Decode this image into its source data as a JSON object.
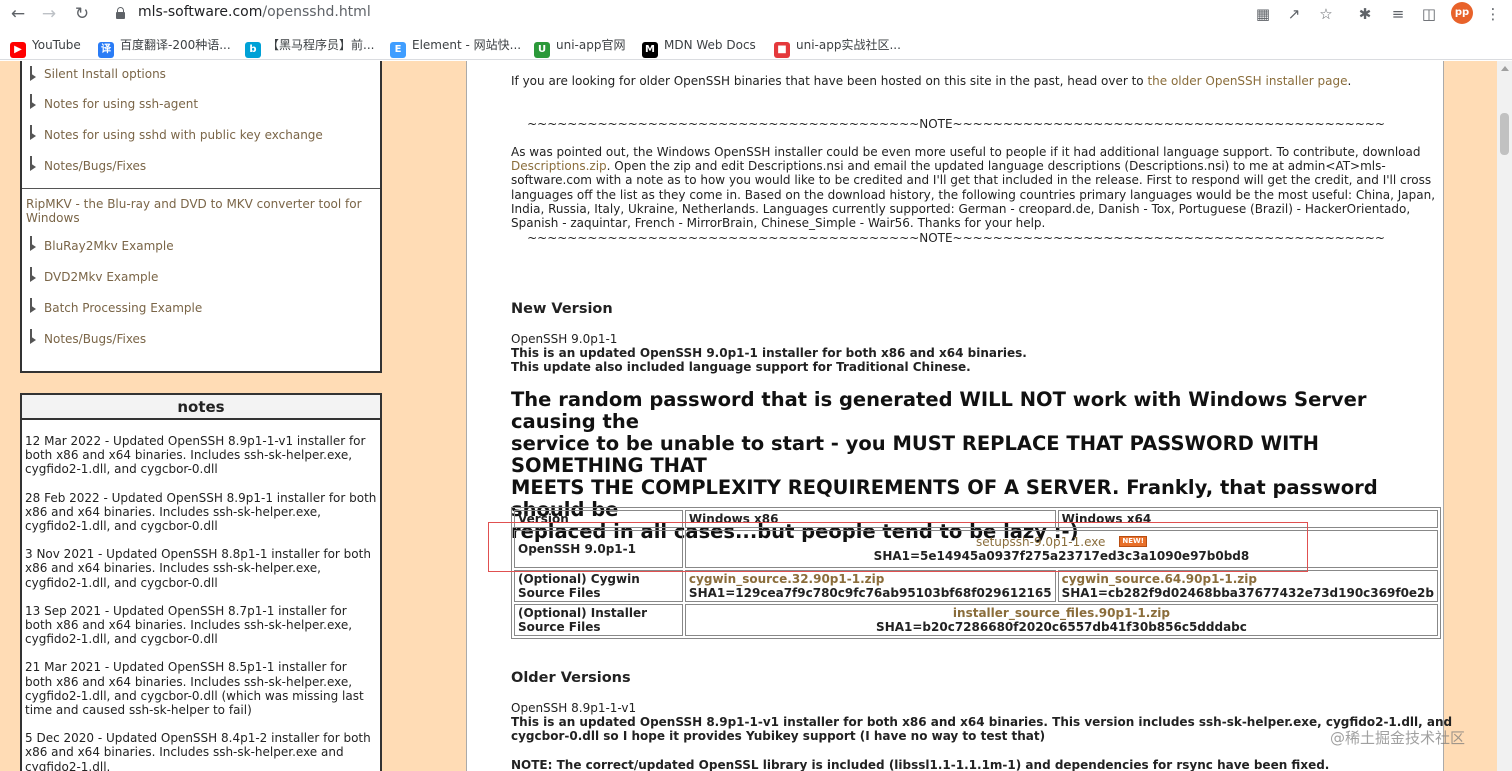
{
  "browser": {
    "url_domain": "mls-software.com",
    "url_path": "/opensshd.html",
    "avatar_initials": "pp",
    "bookmarks": [
      {
        "label": "YouTube",
        "icon": "youtube-icon",
        "color": "#ff0000"
      },
      {
        "label": "百度翻译-200种语...",
        "icon": "baidu-translate-icon",
        "color": "#2a7cf6"
      },
      {
        "label": "【黑马程序员】前...",
        "icon": "bilibili-icon",
        "color": "#00a1d6"
      },
      {
        "label": "Element - 网站快...",
        "icon": "element-icon",
        "color": "#409eff"
      },
      {
        "label": "uni-app官网",
        "icon": "uniapp-icon",
        "color": "#2b9939"
      },
      {
        "label": "MDN Web Docs",
        "icon": "mdn-icon",
        "color": "#000000"
      },
      {
        "label": "uni-app实战社区...",
        "icon": "uniapp-community-icon",
        "color": "#e4393c"
      }
    ]
  },
  "sidebar": {
    "group1": [
      "Silent Install options",
      "Notes for using ssh-agent",
      "Notes for using sshd with public key exchange",
      "Notes/Bugs/Fixes"
    ],
    "group2_head": "RipMKV - the Blu-ray and DVD to MKV converter tool for Windows",
    "group2": [
      "BluRay2Mkv Example",
      "DVD2Mkv Example",
      "Batch Processing Example",
      "Notes/Bugs/Fixes"
    ]
  },
  "notes": {
    "title": "notes",
    "items": [
      "12 Mar 2022 - Updated OpenSSH 8.9p1-1-v1 installer for both x86 and x64 binaries. Includes ssh-sk-helper.exe, cygfido2-1.dll, and cygcbor-0.dll",
      "28 Feb 2022 - Updated OpenSSH 8.9p1-1 installer for both x86 and x64 binaries. Includes ssh-sk-helper.exe, cygfido2-1.dll, and cygcbor-0.dll",
      "3 Nov 2021 - Updated OpenSSH 8.8p1-1 installer for both x86 and x64 binaries. Includes ssh-sk-helper.exe, cygfido2-1.dll, and cygcbor-0.dll",
      "13 Sep 2021 - Updated OpenSSH 8.7p1-1 installer for both x86 and x64 binaries. Includes ssh-sk-helper.exe, cygfido2-1.dll, and cygcbor-0.dll",
      "21 Mar 2021 - Updated OpenSSH 8.5p1-1 installer for both x86 and x64 binaries. Includes ssh-sk-helper.exe, cygfido2-1.dll, and cygcbor-0.dll (which was missing last time and caused ssh-sk-helper to fail)",
      "5 Dec 2020 - Updated OpenSSH 8.4p1-2 installer for both x86 and x64 binaries. Includes ssh-sk-helper.exe and cygfido2-1.dll."
    ]
  },
  "main": {
    "older_intro": "If you are looking for older OpenSSH binaries that have been hosted on this site in the past, head over to ",
    "older_link": "the older OpenSSH installer page",
    "older_end": ".",
    "tilde_note": "~~~~~~~~~~~~~~~~~~~~~~~~~~~~~~~~~~~~~~~NOTE~~~~~~~~~~~~~~~~~~~~~~~~~~~~~~~~~~~~~~~~~~~",
    "lang_1": "As was pointed out, the Windows OpenSSH installer could be even more useful to people if it had additional language support. To contribute, download",
    "lang_link": "Descriptions.zip",
    "lang_2": ". Open the zip and edit Descriptions.nsi and email the updated language descriptions (Descriptions.nsi) to me at admin<AT>mls-",
    "lang_3": "software.com with a note as to how you would like to be credited and I'll get that included in the release. First to respond will get the credit, and I'll cross",
    "lang_4": "languages off the list as they come in. Based on the download history, the following countries primary languages would be the most useful: China, Japan,",
    "lang_5": "India, Russia, Italy, Ukraine, Netherlands. Languages currently supported: German - creopard.de, Danish - Tox, Portuguese (Brazil) - HackerOrientado,",
    "lang_6": "Spanish - zaquintar, French - MirrorBrain, Chinese_Simple - Wair56. Thanks for your help.",
    "new_version_heading": "New Version",
    "nv_line1": "OpenSSH 9.0p1-1",
    "nv_line2": "This is an updated OpenSSH 9.0p1-1 installer for both x86 and x64 binaries.",
    "nv_line3": "This update also included language support for Traditional Chinese.",
    "warning_1": "The random password that is generated WILL NOT work with Windows Server causing the",
    "warning_2": "service to be unable to start - you MUST REPLACE THAT PASSWORD WITH SOMETHING THAT",
    "warning_3": "MEETS THE COMPLEXITY REQUIREMENTS OF A SERVER. Frankly, that password should be",
    "warning_4": "replaced in all cases...but people tend to be lazy :-)",
    "table": {
      "col_version": "Version",
      "col_x86": "Windows x86",
      "col_x64": "Windows x64",
      "row1_label": "OpenSSH 9.0p1-1",
      "row1_link": "setupssh-9.0p1-1.exe",
      "row1_badge": "NEW!",
      "row1_sha": "SHA1=5e14945a0937f275a23717ed3c3a1090e97b0bd8",
      "row2_label_1": "(Optional) Cygwin",
      "row2_label_2": "Source Files",
      "row2_x86_link": "cygwin_source.32.90p1-1.zip",
      "row2_x86_sha": "SHA1=129cea7f9c780c9fc76ab95103bf68f029612165",
      "row2_x64_link": "cygwin_source.64.90p1-1.zip",
      "row2_x64_sha": "SHA1=cb282f9d02468bba37677432e73d190c369f0e2b",
      "row3_label_1": "(Optional) Installer",
      "row3_label_2": "Source Files",
      "row3_link": "installer_source_files.90p1-1.zip",
      "row3_sha": "SHA1=b20c7286680f2020c6557db41f30b856c5dddabc"
    },
    "older_heading": "Older Versions",
    "ov_line1": "OpenSSH 8.9p1-1-v1",
    "ov_line2": "This is an updated OpenSSH 8.9p1-1-v1 installer for both x86 and x64 binaries. This version includes ssh-sk-helper.exe, cygfido2-1.dll, and",
    "ov_line3": "cygcbor-0.dll so I hope it provides Yubikey support (I have no way to test that)",
    "ov_note": "NOTE: The correct/updated OpenSSL library is included (libssl1.1-1.1.1m-1) and dependencies for rsync have been fixed."
  },
  "watermark": "@稀土掘金技术社区"
}
